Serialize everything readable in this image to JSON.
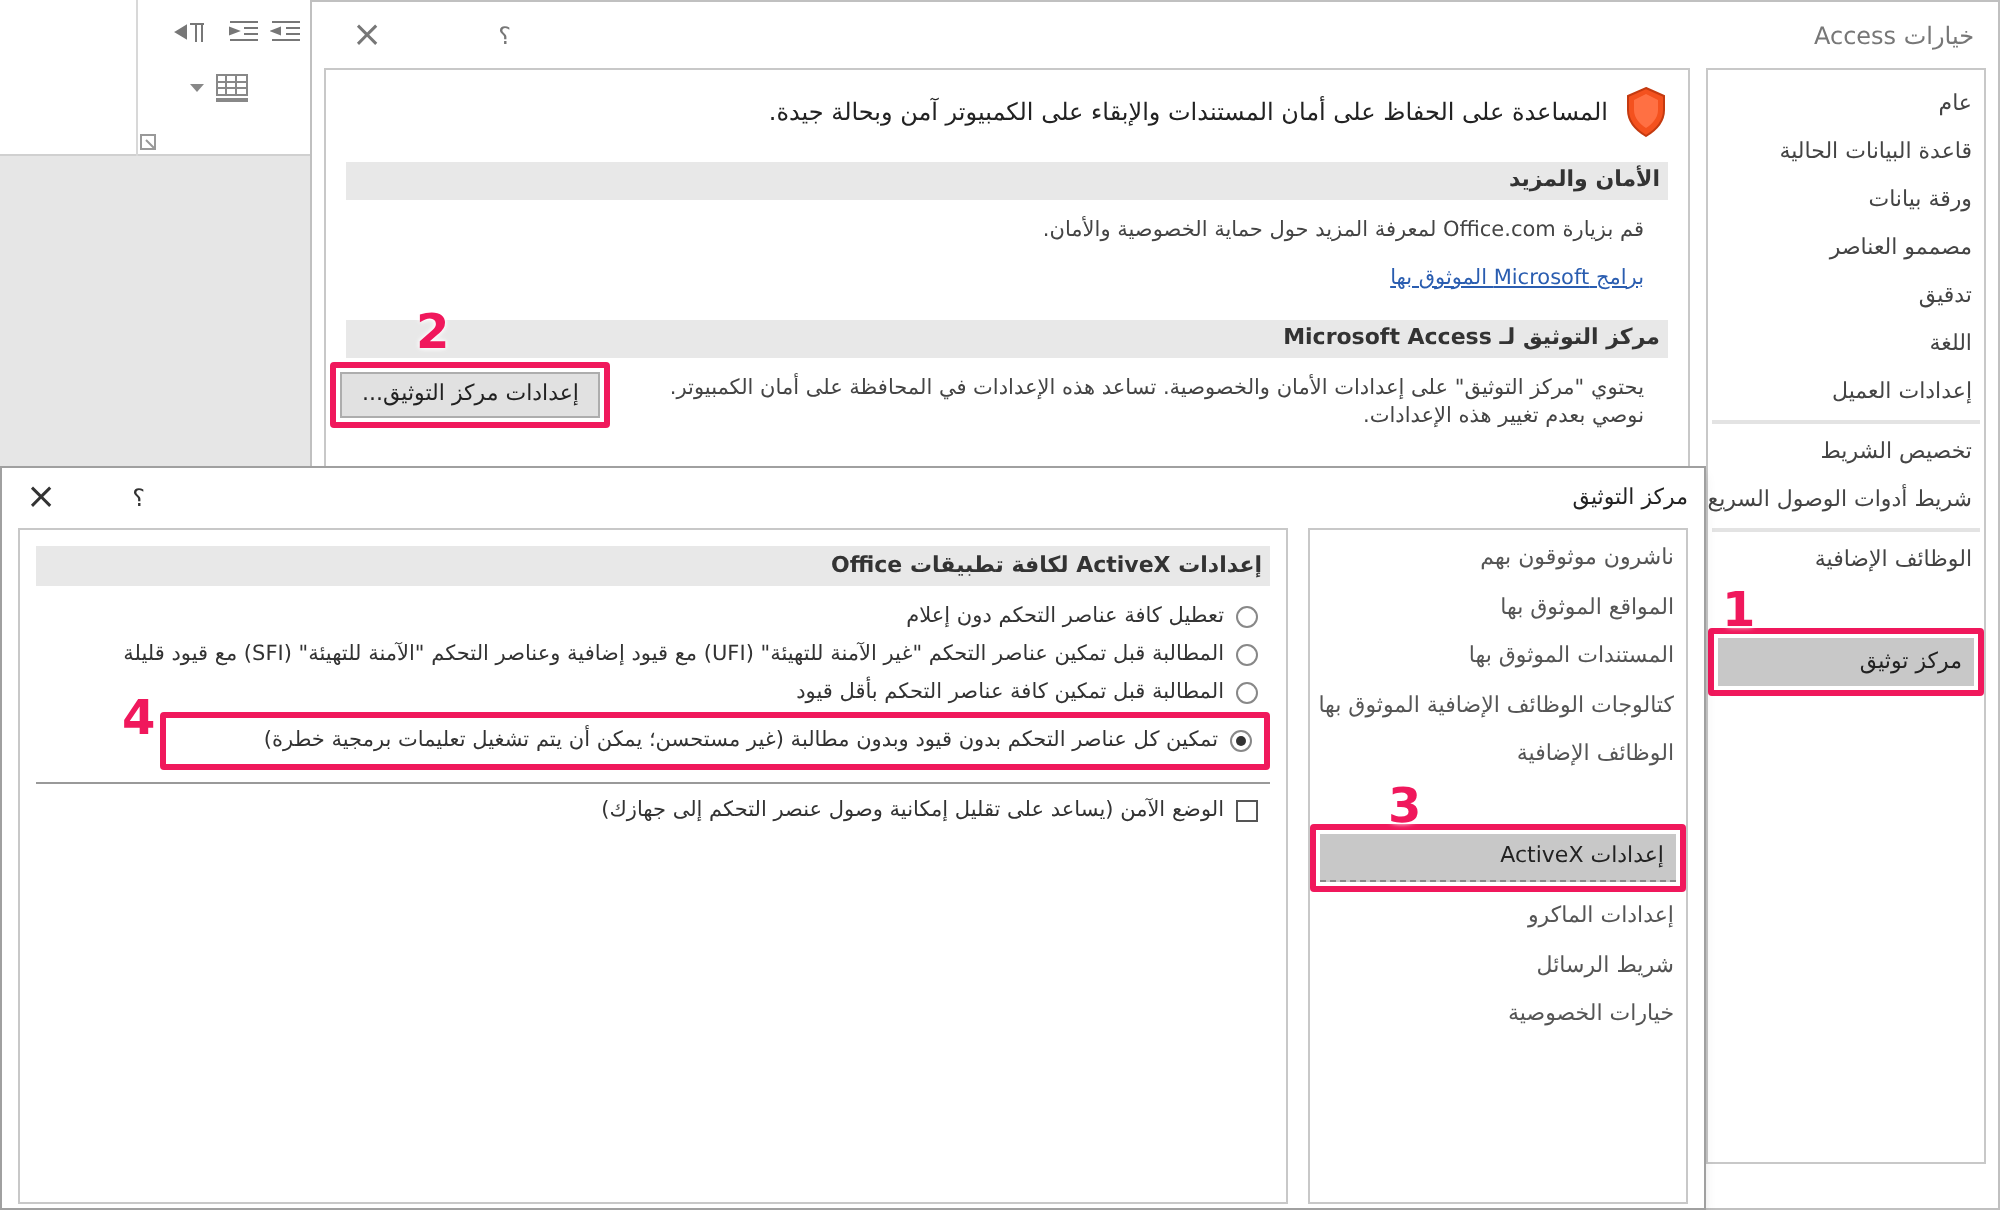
{
  "options_window": {
    "title": "خيارات Access",
    "help": "؟",
    "close": "×",
    "sidebar": [
      [
        {
          "label": "عام",
          "selected": false
        },
        {
          "label": "قاعدة البيانات الحالية",
          "selected": false
        },
        {
          "label": "ورقة بيانات",
          "selected": false
        },
        {
          "label": "مصممو العناصر",
          "selected": false
        },
        {
          "label": "تدقيق",
          "selected": false
        },
        {
          "label": "اللغة",
          "selected": false
        },
        {
          "label": "إعدادات العميل",
          "selected": false
        }
      ],
      [
        {
          "label": "تخصيص الشريط",
          "selected": false
        },
        {
          "label": "شريط أدوات الوصول السريع",
          "selected": false
        }
      ],
      [
        {
          "label": "الوظائف الإضافية",
          "selected": false
        },
        {
          "label": "مركز توثيق",
          "selected": true,
          "callout": "1"
        }
      ]
    ],
    "intro": "المساعدة على الحفاظ على أمان المستندات والإبقاء على الكمبيوتر آمن وبحالة جيدة.",
    "sections": [
      {
        "heading": "الأمان والمزيد",
        "text": "قم بزيارة Office.com لمعرفة المزيد حول حماية الخصوصية والأمان.",
        "link": "برامج Microsoft الموثوق بها"
      },
      {
        "heading": "مركز التوثيق لـ Microsoft Access",
        "text": "يحتوي \"مركز التوثيق\" على إعدادات الأمان والخصوصية. تساعد هذه الإعدادات في المحافظة على أمان الكمبيوتر. نوصي بعدم تغيير هذه الإعدادات.",
        "button": {
          "label": "إعدادات مركز التوثيق...",
          "callout": "2"
        }
      }
    ]
  },
  "trust_center": {
    "title": "مركز التوثيق",
    "help": "؟",
    "close": "×",
    "nav": [
      {
        "label": "ناشرون موثوقون بهم",
        "selected": false
      },
      {
        "label": "المواقع الموثوق بها",
        "selected": false
      },
      {
        "label": "المستندات الموثوق بها",
        "selected": false
      },
      {
        "label": "كتالوجات الوظائف الإضافية الموثوق بها",
        "selected": false
      },
      {
        "label": "الوظائف الإضافية",
        "selected": false
      },
      {
        "label": "إعدادات ActiveX",
        "selected": true,
        "callout": "3"
      },
      {
        "label": "إعدادات الماكرو",
        "selected": false
      },
      {
        "label": "شريط الرسائل",
        "selected": false
      },
      {
        "label": "خيارات الخصوصية",
        "selected": false
      }
    ],
    "heading": "إعدادات ActiveX لكافة تطبيقات Office",
    "options": [
      {
        "label": "تعطيل كافة عناصر التحكم دون إعلام",
        "selected": false
      },
      {
        "label": "المطالبة قبل تمكين عناصر التحكم \"غير الآمنة للتهيئة\" (UFI) مع قيود إضافية وعناصر التحكم \"الآمنة للتهيئة\" (SFI) مع قيود قليلة",
        "selected": false
      },
      {
        "label": "المطالبة قبل تمكين كافة عناصر التحكم بأقل قيود",
        "selected": false
      },
      {
        "label": "تمكين كل عناصر التحكم بدون قيود وبدون مطالبة (غير مستحسن؛ يمكن أن يتم تشغيل تعليمات برمجية خطرة)",
        "selected": true,
        "callout": "4"
      }
    ],
    "safe_mode": {
      "label": "الوضع الآمن (يساعد على تقليل إمكانية وصول عنصر التحكم إلى جهازك)",
      "checked": false
    }
  }
}
